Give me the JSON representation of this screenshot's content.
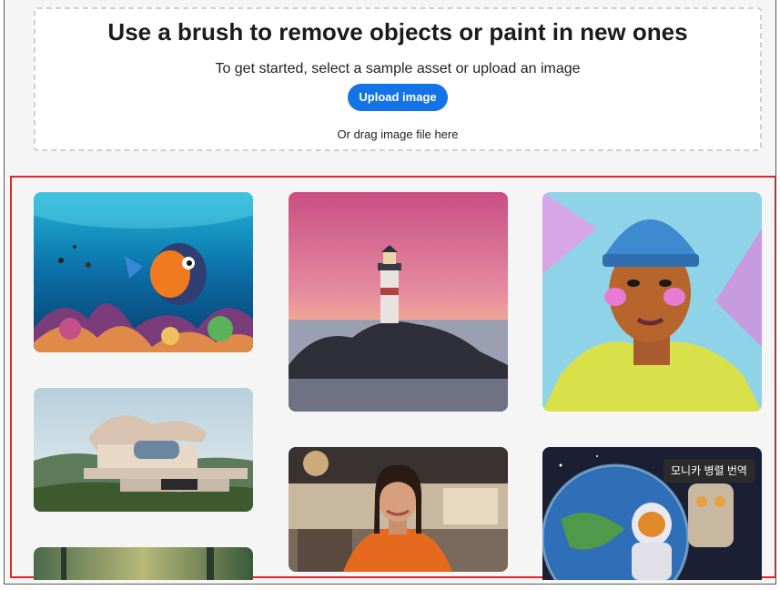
{
  "upload": {
    "title": "Use a brush to remove objects or paint in new ones",
    "subtitle": "To get started, select a sample asset or upload an image",
    "button_label": "Upload image",
    "drag_hint": "Or drag image file here"
  },
  "gallery": {
    "items": [
      {
        "subject": "underwater clownfish coral reef"
      },
      {
        "subject": "lighthouse on rocks at sunset"
      },
      {
        "subject": "portrait of young man in blue beanie"
      },
      {
        "subject": "modern curved house on hillside"
      },
      {
        "subject": "woman in orange jacket at cafe"
      },
      {
        "subject": "astronaut with earth and robot"
      },
      {
        "subject": "forest"
      }
    ]
  },
  "tooltip": {
    "text": "모니카 병렬 번역"
  }
}
